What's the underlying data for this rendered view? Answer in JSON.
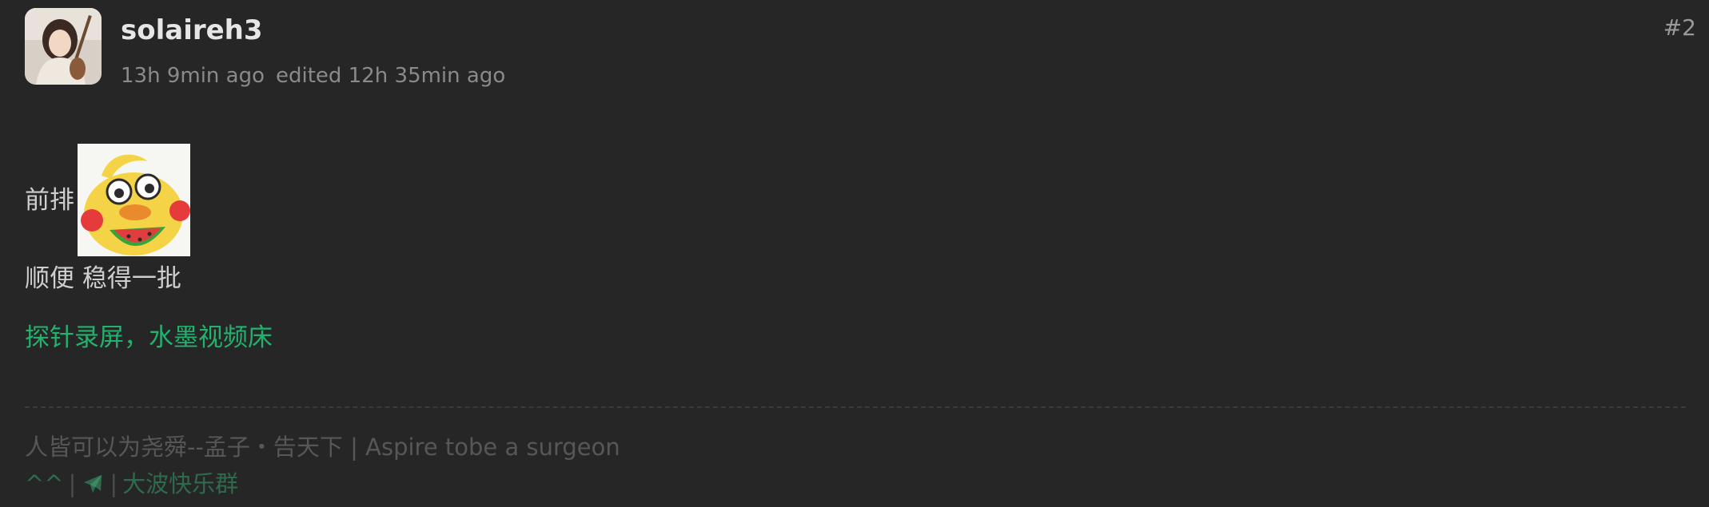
{
  "post": {
    "username": "solaireh3",
    "time_ago": "13h 9min ago",
    "edited": "edited 12h 35min ago",
    "number": "#2"
  },
  "content": {
    "line1": "前排",
    "sticker_icon": "duck-eating-watermelon-sticker",
    "line2": "顺便 稳得一批",
    "link_text": "探针录屏，水墨视频床",
    "link_color": "#23b26d"
  },
  "signature": {
    "line1": "人皆可以为尧舜--孟子・告天下 | Aspire tobe a surgeon",
    "caret": "^^",
    "sep1": "|",
    "plane_icon": "airplane-icon",
    "sep2": "|",
    "group": "大波快乐群"
  },
  "colors": {
    "background": "#262626",
    "signature_link": "#2f6a4c"
  }
}
